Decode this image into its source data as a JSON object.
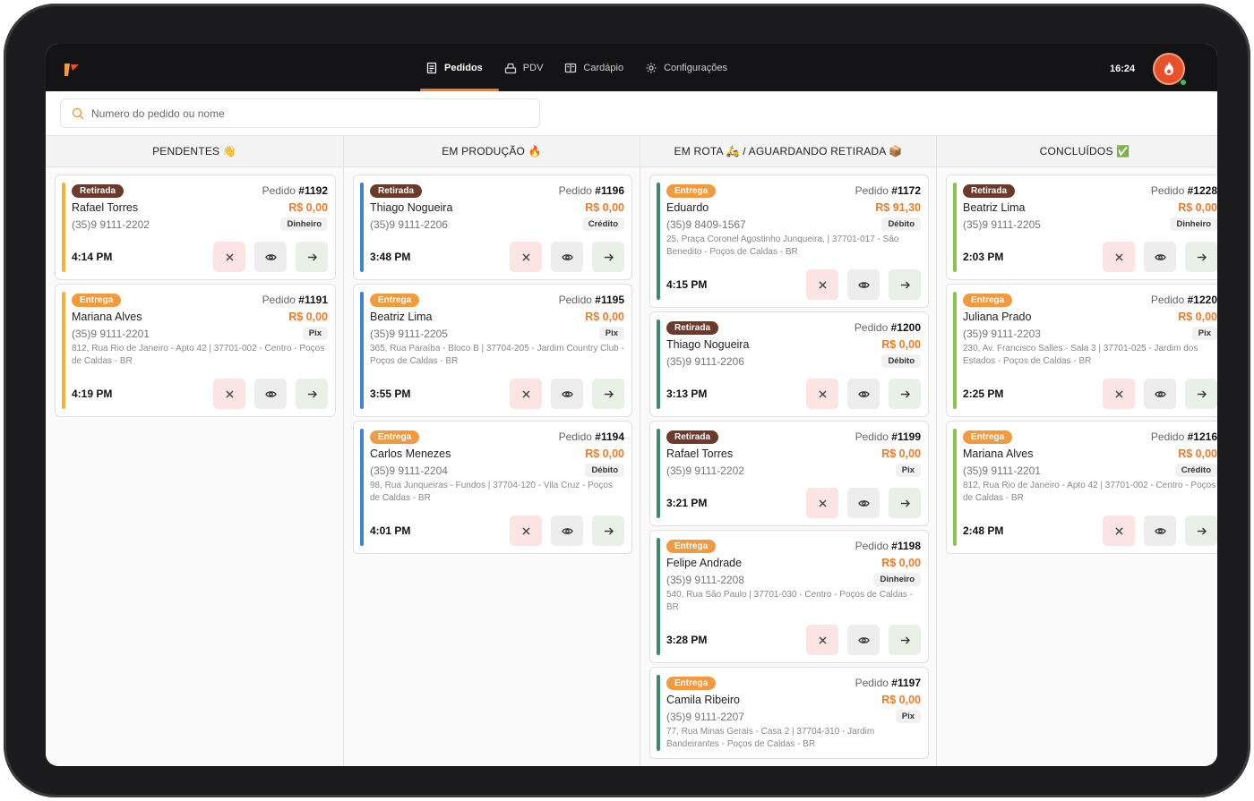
{
  "nav": {
    "items": [
      {
        "label": "Pedidos",
        "active": true,
        "icon": "receipt-icon"
      },
      {
        "label": "PDV",
        "active": false,
        "icon": "register-icon"
      },
      {
        "label": "Cardápio",
        "active": false,
        "icon": "menu-book-icon"
      },
      {
        "label": "Configurações",
        "active": false,
        "icon": "gear-icon"
      }
    ],
    "clock": "16:24"
  },
  "search": {
    "placeholder": "Numero do pedido ou nome"
  },
  "colors": {
    "pendentes": "#f5b335",
    "producao": "#3f82d9",
    "rota": "#3f8a6d",
    "concluidos": "#8bc34a",
    "accent": "#ee7d2a",
    "retirada": "#6b3a2b",
    "entrega": "#f29a3f"
  },
  "columns": [
    {
      "title": "PENDENTES 👋",
      "cards": [
        {
          "type": "Retirada",
          "order_label": "Pedido",
          "order_no": "#1192",
          "name": "Rafael Torres",
          "price": "R$ 0,00",
          "phone": "(35)9 9111-2202",
          "payment": "Dinheiro",
          "address": "",
          "time": "4:14 PM"
        },
        {
          "type": "Entrega",
          "order_label": "Pedido",
          "order_no": "#1191",
          "name": "Mariana Alves",
          "price": "R$ 0,00",
          "phone": "(35)9 9111-2201",
          "payment": "Pix",
          "address": "812, Rua Rio de Janeiro - Apto 42 | 37701-002 - Centro - Poços de Caldas - BR",
          "time": "4:19 PM"
        }
      ]
    },
    {
      "title": "EM PRODUÇÃO 🔥",
      "cards": [
        {
          "type": "Retirada",
          "order_label": "Pedido",
          "order_no": "#1196",
          "name": "Thiago Nogueira",
          "price": "R$ 0,00",
          "phone": "(35)9 9111-2206",
          "payment": "Crédito",
          "address": "",
          "time": "3:48 PM"
        },
        {
          "type": "Entrega",
          "order_label": "Pedido",
          "order_no": "#1195",
          "name": "Beatriz Lima",
          "price": "R$ 0,00",
          "phone": "(35)9 9111-2205",
          "payment": "Pix",
          "address": "365, Rua Paraíba - Bloco B | 37704-205 - Jardim Country Club - Poços de Caldas - BR",
          "time": "3:55 PM"
        },
        {
          "type": "Entrega",
          "order_label": "Pedido",
          "order_no": "#1194",
          "name": "Carlos Menezes",
          "price": "R$ 0,00",
          "phone": "(35)9 9111-2204",
          "payment": "Débito",
          "address": "98, Rua Junqueiras - Fundos | 37704-120 - Vila Cruz - Poços de Caldas - BR",
          "time": "4:01 PM"
        }
      ]
    },
    {
      "title": "EM ROTA 🛵 / AGUARDANDO RETIRADA 📦",
      "cards": [
        {
          "type": "Entrega",
          "order_label": "Pedido",
          "order_no": "#1172",
          "name": "Eduardo",
          "price": "R$ 91,30",
          "phone": "(35)9 8409-1567",
          "payment": "Débito",
          "address": "25, Praça Coronel Agostinho Junqueira, | 37701-017 - São Benedito - Poços de Caldas - BR",
          "time": "4:15 PM"
        },
        {
          "type": "Retirada",
          "order_label": "Pedido",
          "order_no": "#1200",
          "name": "Thiago Nogueira",
          "price": "R$ 0,00",
          "phone": "(35)9 9111-2206",
          "payment": "Débito",
          "address": "",
          "time": "3:13 PM"
        },
        {
          "type": "Retirada",
          "order_label": "Pedido",
          "order_no": "#1199",
          "name": "Rafael Torres",
          "price": "R$ 0,00",
          "phone": "(35)9 9111-2202",
          "payment": "Pix",
          "address": "",
          "time": "3:21 PM"
        },
        {
          "type": "Entrega",
          "order_label": "Pedido",
          "order_no": "#1198",
          "name": "Felipe Andrade",
          "price": "R$ 0,00",
          "phone": "(35)9 9111-2208",
          "payment": "Dinheiro",
          "address": "540, Rua São Paulo | 37701-030 - Centro - Poços de Caldas - BR",
          "time": "3:28 PM"
        },
        {
          "type": "Entrega",
          "order_label": "Pedido",
          "order_no": "#1197",
          "name": "Camila Ribeiro",
          "price": "R$ 0,00",
          "phone": "(35)9 9111-2207",
          "payment": "Pix",
          "address": "77, Rua Minas Gerais - Casa 2 | 37704-310 - Jardim Bandeirantes - Poços de Caldas - BR",
          "time": ""
        }
      ]
    },
    {
      "title": "CONCLUÍDOS ✅",
      "cards": [
        {
          "type": "Retirada",
          "order_label": "Pedido",
          "order_no": "#1228",
          "name": "Beatriz Lima",
          "price": "R$ 0,00",
          "phone": "(35)9 9111-2205",
          "payment": "Dinheiro",
          "address": "",
          "time": "2:03 PM"
        },
        {
          "type": "Entrega",
          "order_label": "Pedido",
          "order_no": "#1220",
          "name": "Juliana Prado",
          "price": "R$ 0,00",
          "phone": "(35)9 9111-2203",
          "payment": "Pix",
          "address": "230, Av. Francisco Salles - Sala 3 | 37701-025 - Jardim dos Estados - Poços de Caldas - BR",
          "time": "2:25 PM"
        },
        {
          "type": "Entrega",
          "order_label": "Pedido",
          "order_no": "#1216",
          "name": "Mariana Alves",
          "price": "R$ 0,00",
          "phone": "(35)9 9111-2201",
          "payment": "Crédito",
          "address": "812, Rua Rio de Janeiro - Apto 42 | 37701-002 - Centro - Poços de Caldas - BR",
          "time": "2:48 PM"
        }
      ]
    }
  ]
}
